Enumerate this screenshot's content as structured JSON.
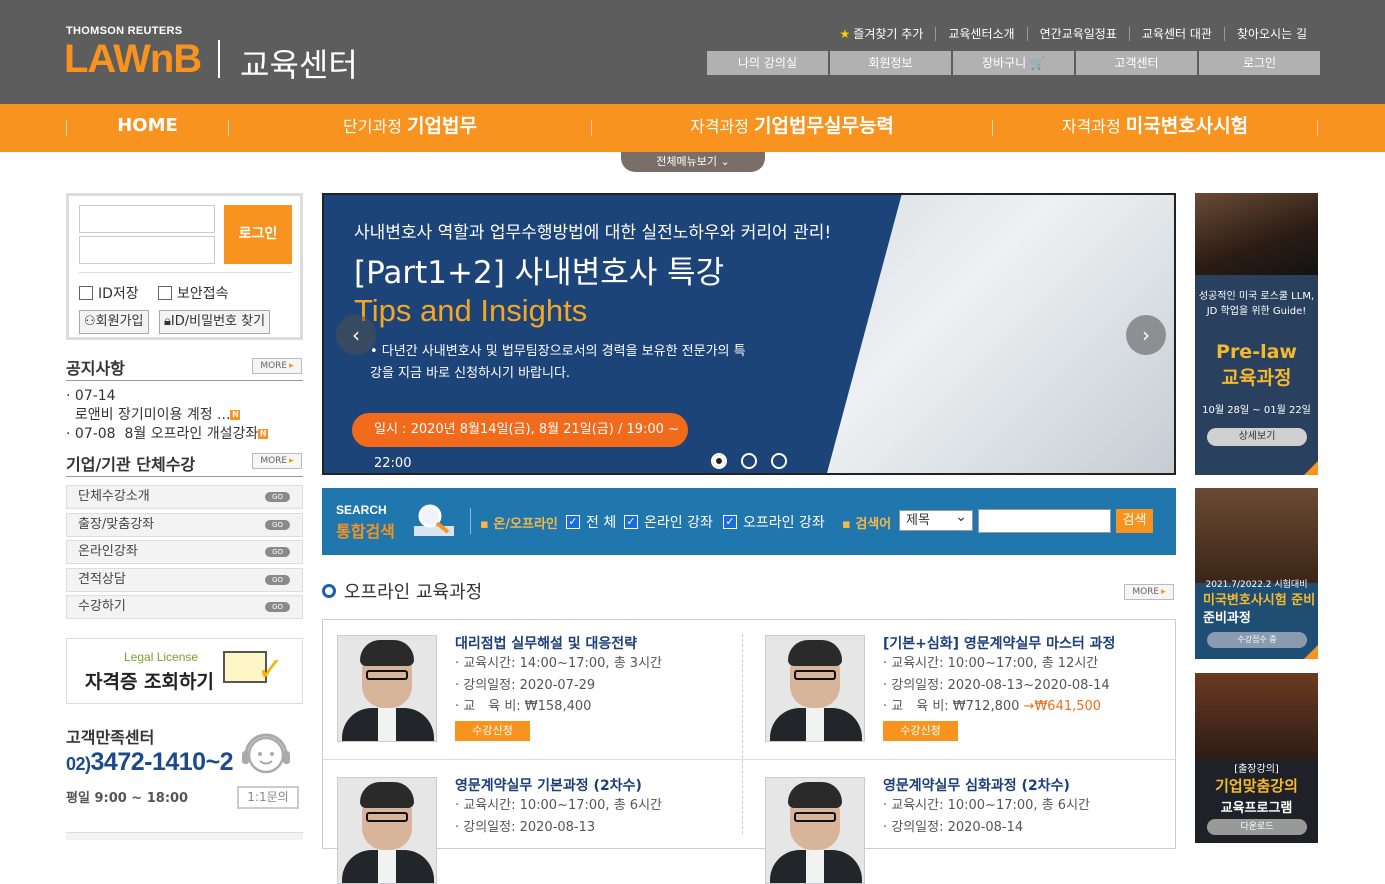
{
  "header": {
    "brand_top": "THOMSON REUTERS",
    "brand_main": "LAWnB",
    "brand_sub": "교육센터",
    "util_links": [
      "즐겨찾기 추가",
      "교육센터소개",
      "연간교육일정표",
      "교육센터 대관",
      "찾아오시는 길"
    ],
    "gnb_buttons": [
      "나의 강의실",
      "회원정보",
      "장바구니 🛒",
      "고객센터",
      "로그인"
    ]
  },
  "nav": {
    "home": "HOME",
    "item1_pre": "단기과정",
    "item1_main": "기업법무",
    "item2_pre": "자격과정",
    "item2_main": "기업법무실무능력",
    "item3_pre": "자격과정",
    "item3_main": "미국변호사시험",
    "all_menu": "전체메뉴보기 ⌄"
  },
  "login": {
    "button": "로그인",
    "save_id": "ID저장",
    "secure": "보안접속",
    "join": "회원가입",
    "find": "ID/비밀번호 찾기"
  },
  "notice": {
    "title": "공지사항",
    "more": "MORE",
    "items": [
      {
        "date": "07-14",
        "text": "로앤비 장기미이용 계정 ..."
      },
      {
        "date": "07-08",
        "text": "8월 오프라인 개설강좌"
      }
    ],
    "badge": "N"
  },
  "group": {
    "title": "기업/기관 단체수강",
    "more": "MORE",
    "go": "GO",
    "items": [
      "단체수강소개",
      "출장/맞춤강좌",
      "온라인강좌",
      "견적상담",
      "수강하기"
    ]
  },
  "license": {
    "line1": "Legal License",
    "line2": "자격증 조회하기"
  },
  "cs": {
    "title": "고객만족센터",
    "phone_area": "02)",
    "phone": "3472-1410~2",
    "hours": "평일 9:00 ~ 18:00",
    "qna": "1:1문의"
  },
  "banner": {
    "line1": "사내변호사 역할과 업무수행방법에 대한 실전노하우와 커리어 관리!",
    "line2": "[Part1+2] 사내변호사 특강",
    "line3": "Tips and Insights",
    "line4": "• 다년간 사내변호사 및 법무팀장으로서의 경력을 보유한 전문가의 특강을 지금 바로 신청하시기 바랍니다.",
    "schedule": "일시 : 2020년 8월14일(금), 8월 21일(금) / 19:00 ~ 22:00",
    "prev": "‹",
    "next": "›",
    "slide_count": 3,
    "active_slide": 1
  },
  "search": {
    "label_en": "SEARCH",
    "label_ko": "통합검색",
    "filter_label": "▪ 온/오프라인",
    "options": [
      "전 체",
      "온라인 강좌",
      "오프라인 강좌"
    ],
    "keyword_label": "▪ 검색어",
    "select_value": "제목",
    "button": "검색"
  },
  "offline": {
    "title": "오프라인 교육과정",
    "more": "MORE",
    "apply": "수강신청",
    "courses": [
      {
        "title": "대리점법 실무해설 및 대응전략",
        "time": "· 교육시간: 14:00~17:00, 총 3시간",
        "date": "· 강의일정: 2020-07-29",
        "fee": "· 교　육 비: ₩158,400",
        "sale": ""
      },
      {
        "title": "[기본+심화] 영문계약실무 마스터 과정",
        "time": "· 교육시간: 10:00~17:00, 총 12시간",
        "date": "· 강의일정: 2020-08-13~2020-08-14",
        "fee": "· 교　육 비: ₩712,800",
        "sale": "→₩641,500"
      },
      {
        "title": "영문계약실무 기본과정 (2차수)",
        "time": "· 교육시간: 10:00~17:00, 총 6시간",
        "date": "· 강의일정: 2020-08-13",
        "fee": "",
        "sale": ""
      },
      {
        "title": "영문계약실무 심화과정 (2차수)",
        "time": "· 교육시간: 10:00~17:00, 총 6시간",
        "date": "· 강의일정: 2020-08-14",
        "fee": "",
        "sale": ""
      }
    ]
  },
  "side": {
    "b1_text": "성공적인 미국 로스쿨 LLM, JD 학업을 위한 Guide!",
    "b1_big1": "Pre-law",
    "b1_big2": "교육과정",
    "b1_date": "10월 28일 ~ 01월 22일",
    "b1_btn": "상세보기",
    "b2_date": "2021.7/2022.2 시험대비",
    "b2_t1": "미국변호사시험 준비",
    "b2_t2": "준비과정",
    "b2_btn": "수강접수 중",
    "b3_t1": "[출장강의]",
    "b3_t2": "기업맞춤강의",
    "b3_t3": "교육프로그램",
    "b3_btn": "다운로드"
  }
}
